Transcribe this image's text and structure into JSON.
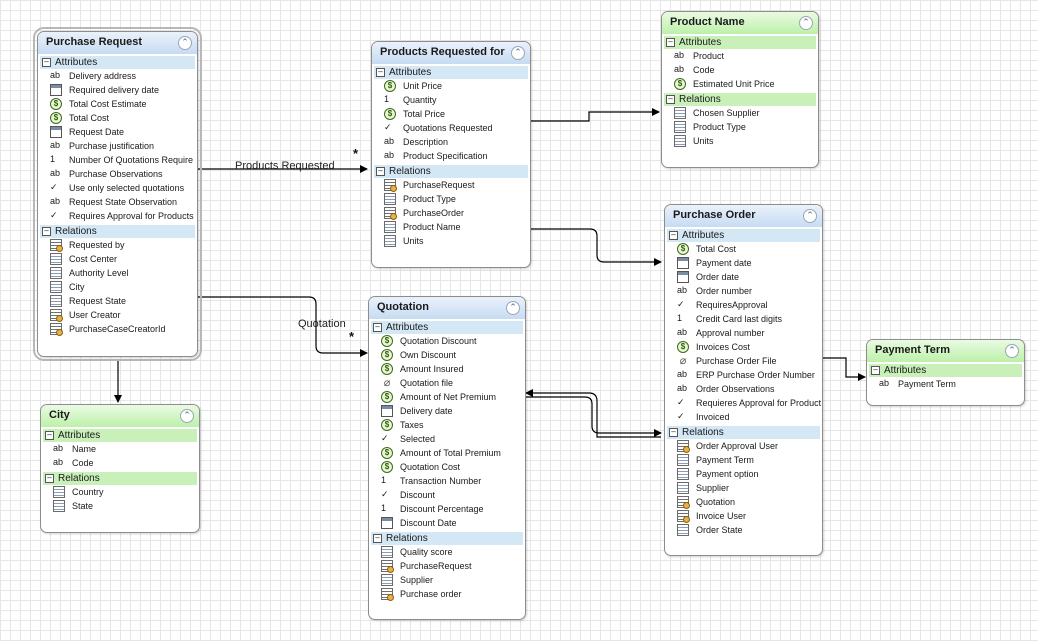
{
  "links": {
    "products_requested_label": "Products Requested",
    "products_requested_mult": "*",
    "quotation_label": "Quotation",
    "quotation_mult": "*"
  },
  "icons": {
    "text": "ab",
    "money": "$",
    "number": "1",
    "boolean": "✓",
    "collapse": "⌃",
    "clip": "⌀"
  },
  "entities": [
    {
      "id": "purchase-request",
      "title": "Purchase Request",
      "header": "blue",
      "selected": true,
      "attributes_label": "Attributes",
      "relations_label": "Relations",
      "attributes": [
        {
          "icon": "text",
          "label": "Delivery address"
        },
        {
          "icon": "date",
          "label": "Required delivery date"
        },
        {
          "icon": "money",
          "label": "Total Cost Estimate"
        },
        {
          "icon": "money",
          "label": "Total Cost"
        },
        {
          "icon": "date",
          "label": "Request Date"
        },
        {
          "icon": "text",
          "label": "Purchase justification"
        },
        {
          "icon": "number",
          "label": "Number Of Quotations Require"
        },
        {
          "icon": "text",
          "label": "Purchase Observations"
        },
        {
          "icon": "boolean",
          "label": "Use only selected quotations"
        },
        {
          "icon": "text",
          "label": "Request State Observation"
        },
        {
          "icon": "boolean",
          "label": "Requires Approval for Products"
        }
      ],
      "relations": [
        {
          "icon": "relu",
          "label": "Requested by"
        },
        {
          "icon": "rel",
          "label": "Cost Center"
        },
        {
          "icon": "rel",
          "label": "Authority Level"
        },
        {
          "icon": "rel",
          "label": "City"
        },
        {
          "icon": "rel",
          "label": "Request State"
        },
        {
          "icon": "relu",
          "label": "User Creator"
        },
        {
          "icon": "relu",
          "label": "PurchaseCaseCreatorId"
        }
      ]
    },
    {
      "id": "city",
      "title": "City",
      "header": "green",
      "selected": false,
      "attributes_label": "Attributes",
      "relations_label": "Relations",
      "attributes": [
        {
          "icon": "text",
          "label": "Name"
        },
        {
          "icon": "text",
          "label": "Code"
        }
      ],
      "relations": [
        {
          "icon": "rel",
          "label": "Country"
        },
        {
          "icon": "rel",
          "label": "State"
        }
      ]
    },
    {
      "id": "products-requested",
      "title": "Products Requested for Pro",
      "header": "blue",
      "selected": false,
      "attributes_label": "Attributes",
      "relations_label": "Relations",
      "attributes": [
        {
          "icon": "money",
          "label": "Unit Price"
        },
        {
          "icon": "number",
          "label": "Quantity"
        },
        {
          "icon": "money",
          "label": "Total Price"
        },
        {
          "icon": "boolean",
          "label": "Quotations Requested"
        },
        {
          "icon": "text",
          "label": "Description"
        },
        {
          "icon": "text",
          "label": "Product Specification"
        }
      ],
      "relations": [
        {
          "icon": "relu",
          "label": "PurchaseRequest"
        },
        {
          "icon": "rel",
          "label": "Product Type"
        },
        {
          "icon": "relu",
          "label": "PurchaseOrder"
        },
        {
          "icon": "rel",
          "label": "Product Name"
        },
        {
          "icon": "rel",
          "label": "Units"
        }
      ]
    },
    {
      "id": "quotation",
      "title": "Quotation",
      "header": "blue",
      "selected": false,
      "attributes_label": "Attributes",
      "relations_label": "Relations",
      "attributes": [
        {
          "icon": "money",
          "label": "Quotation Discount"
        },
        {
          "icon": "money",
          "label": "Own Discount"
        },
        {
          "icon": "money",
          "label": "Amount Insured"
        },
        {
          "icon": "clip",
          "label": "Quotation file"
        },
        {
          "icon": "money",
          "label": "Amount of Net Premium"
        },
        {
          "icon": "date",
          "label": "Delivery date"
        },
        {
          "icon": "money",
          "label": "Taxes"
        },
        {
          "icon": "boolean",
          "label": "Selected"
        },
        {
          "icon": "money",
          "label": "Amount of Total Premium"
        },
        {
          "icon": "money",
          "label": "Quotation Cost"
        },
        {
          "icon": "number",
          "label": "Transaction Number"
        },
        {
          "icon": "boolean",
          "label": "Discount"
        },
        {
          "icon": "number",
          "label": "Discount Percentage"
        },
        {
          "icon": "date",
          "label": "Discount Date"
        }
      ],
      "relations": [
        {
          "icon": "rel",
          "label": "Quality score"
        },
        {
          "icon": "relu",
          "label": "PurchaseRequest"
        },
        {
          "icon": "rel",
          "label": "Supplier"
        },
        {
          "icon": "relu",
          "label": "Purchase order"
        }
      ]
    },
    {
      "id": "product-name",
      "title": "Product Name",
      "header": "green",
      "selected": false,
      "attributes_label": "Attributes",
      "relations_label": "Relations",
      "attributes": [
        {
          "icon": "text",
          "label": "Product"
        },
        {
          "icon": "text",
          "label": "Code"
        },
        {
          "icon": "money",
          "label": "Estimated Unit Price"
        }
      ],
      "relations": [
        {
          "icon": "rel",
          "label": "Chosen Supplier"
        },
        {
          "icon": "rel",
          "label": "Product Type"
        },
        {
          "icon": "rel",
          "label": "Units"
        }
      ]
    },
    {
      "id": "purchase-order",
      "title": "Purchase Order",
      "header": "blue",
      "selected": false,
      "attributes_label": "Attributes",
      "relations_label": "Relations",
      "attributes": [
        {
          "icon": "money",
          "label": "Total Cost"
        },
        {
          "icon": "date",
          "label": "Payment date"
        },
        {
          "icon": "date",
          "label": "Order date"
        },
        {
          "icon": "text",
          "label": "Order number"
        },
        {
          "icon": "boolean",
          "label": "RequiresApproval"
        },
        {
          "icon": "number",
          "label": "Credit Card last digits"
        },
        {
          "icon": "text",
          "label": "Approval number"
        },
        {
          "icon": "money",
          "label": "Invoices Cost"
        },
        {
          "icon": "clip",
          "label": "Purchase Order File"
        },
        {
          "icon": "text",
          "label": "ERP Purchase Order Number"
        },
        {
          "icon": "text",
          "label": "Order Observations"
        },
        {
          "icon": "boolean",
          "label": "Requieres Approval for Product"
        },
        {
          "icon": "boolean",
          "label": "Invoiced"
        }
      ],
      "relations": [
        {
          "icon": "relu",
          "label": "Order Approval User"
        },
        {
          "icon": "rel",
          "label": "Payment Term"
        },
        {
          "icon": "rel",
          "label": "Payment option"
        },
        {
          "icon": "rel",
          "label": "Supplier"
        },
        {
          "icon": "relu",
          "label": "Quotation"
        },
        {
          "icon": "relu",
          "label": "Invoice User"
        },
        {
          "icon": "rel",
          "label": "Order State"
        }
      ]
    },
    {
      "id": "payment-term",
      "title": "Payment Term",
      "header": "green",
      "selected": false,
      "attributes_label": "Attributes",
      "relations_label": "",
      "attributes": [
        {
          "icon": "text",
          "label": "Payment Term"
        }
      ],
      "relations": []
    }
  ]
}
